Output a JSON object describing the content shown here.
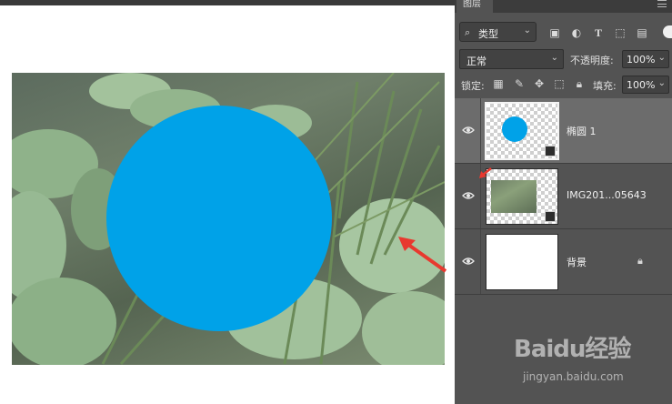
{
  "canvas": {
    "shape_color": "#00a2e8",
    "annotation_arrow_color": "#e8392f"
  },
  "layers_panel": {
    "tab_label": "图层",
    "filter": {
      "kind_label": "类型",
      "icons": [
        "search-icon",
        "image-filter-icon",
        "adjustment-filter-icon",
        "text-filter-icon",
        "shape-filter-icon",
        "smart-object-filter-icon"
      ]
    },
    "blend_mode": "正常",
    "opacity_label": "不透明度:",
    "opacity_value": "100%",
    "lock_label": "锁定:",
    "lock_icons": [
      "lock-transparent-icon",
      "lock-brush-icon",
      "lock-move-icon",
      "lock-artboard-icon",
      "lock-all-icon"
    ],
    "fill_label": "填充:",
    "fill_value": "100%",
    "layers": [
      {
        "name": "椭圆 1",
        "type": "shape",
        "selected": true,
        "visible": true
      },
      {
        "name": "IMG201...05643",
        "type": "smart-object",
        "selected": false,
        "visible": true
      },
      {
        "name": "背景",
        "type": "background",
        "selected": false,
        "visible": true,
        "locked": true
      }
    ]
  },
  "watermark": {
    "logo_text": "Baidu经验",
    "url_text": "jingyan.baidu.com"
  }
}
